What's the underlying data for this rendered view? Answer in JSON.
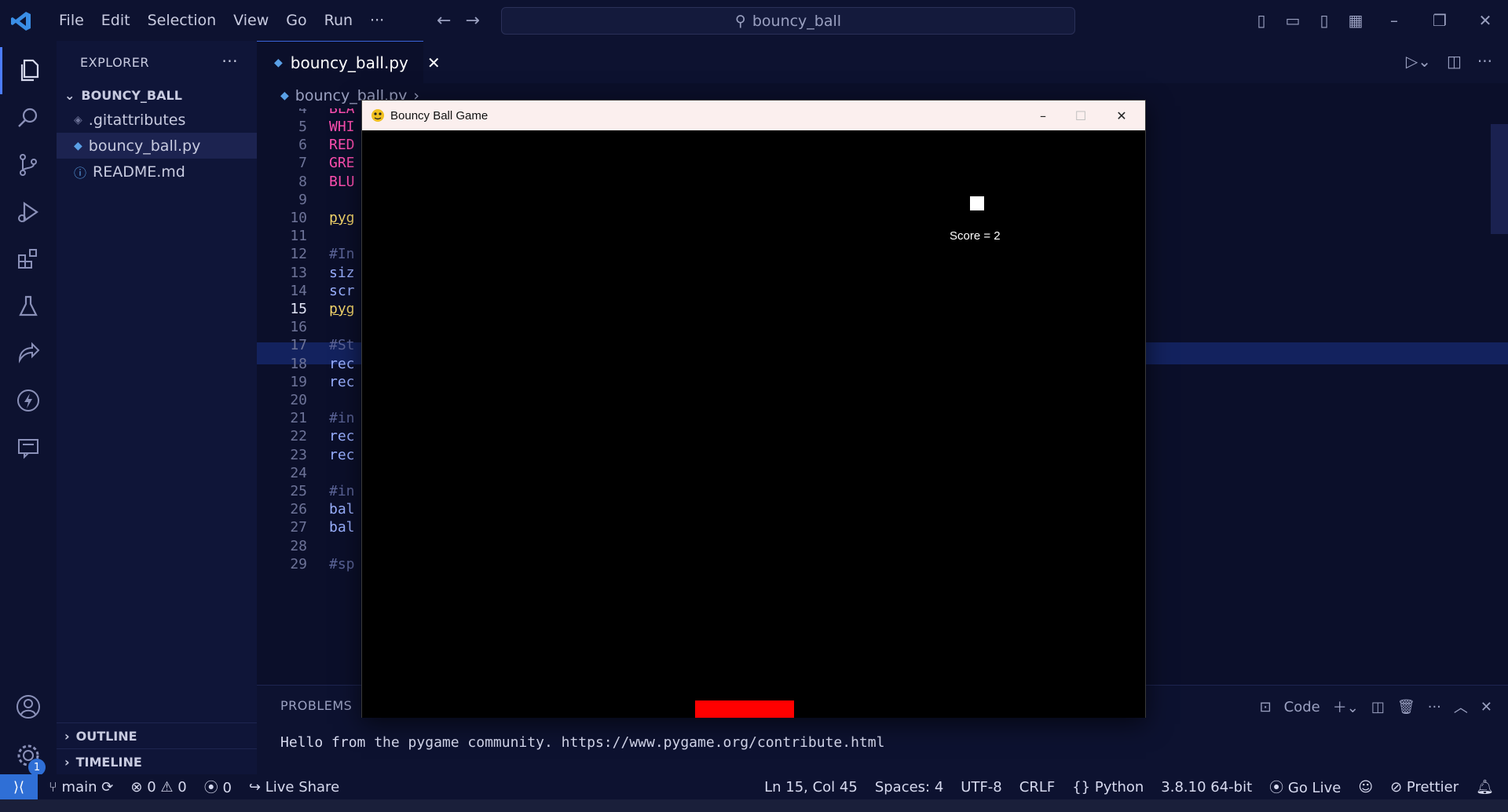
{
  "titlebar": {
    "menu": [
      "File",
      "Edit",
      "Selection",
      "View",
      "Go",
      "Run",
      "···"
    ],
    "search": "bouncy_ball"
  },
  "activity": {
    "badge": "1"
  },
  "sidebar": {
    "header": "EXPLORER",
    "project": "BOUNCY_BALL",
    "files": [
      ".gitattributes",
      "bouncy_ball.py",
      "README.md"
    ],
    "outline": "OUTLINE",
    "timeline": "TIMELINE"
  },
  "editor": {
    "tab": "bouncy_ball.py",
    "breadcrumb": "bouncy_ball.py",
    "lines": [
      {
        "n": "4",
        "t": "BLA",
        "c": "#ff4fb0"
      },
      {
        "n": "5",
        "t": "WHI",
        "c": "#ff4fb0"
      },
      {
        "n": "6",
        "t": "RED",
        "c": "#ff4fb0"
      },
      {
        "n": "7",
        "t": "GRE",
        "c": "#ff4fb0"
      },
      {
        "n": "8",
        "t": "BLU",
        "c": "#ff4fb0"
      },
      {
        "n": "9",
        "t": "",
        "c": "#c8cbe0"
      },
      {
        "n": "10",
        "t": "pyg",
        "c": "#f3d56b"
      },
      {
        "n": "11",
        "t": "",
        "c": "#c8cbe0"
      },
      {
        "n": "12",
        "t": "#In",
        "c": "#5a6396"
      },
      {
        "n": "13",
        "t": "siz",
        "c": "#9ab0ff"
      },
      {
        "n": "14",
        "t": "scr",
        "c": "#9ab0ff"
      },
      {
        "n": "15",
        "t": "pyg",
        "c": "#f3d56b"
      },
      {
        "n": "16",
        "t": "",
        "c": "#c8cbe0"
      },
      {
        "n": "17",
        "t": "#St",
        "c": "#5a6396"
      },
      {
        "n": "18",
        "t": "rec",
        "c": "#9ab0ff"
      },
      {
        "n": "19",
        "t": "rec",
        "c": "#9ab0ff"
      },
      {
        "n": "20",
        "t": "",
        "c": "#c8cbe0"
      },
      {
        "n": "21",
        "t": "#in",
        "c": "#5a6396"
      },
      {
        "n": "22",
        "t": "rec",
        "c": "#9ab0ff"
      },
      {
        "n": "23",
        "t": "rec",
        "c": "#9ab0ff"
      },
      {
        "n": "24",
        "t": "",
        "c": "#c8cbe0"
      },
      {
        "n": "25",
        "t": "#in",
        "c": "#5a6396"
      },
      {
        "n": "26",
        "t": "bal",
        "c": "#9ab0ff"
      },
      {
        "n": "27",
        "t": "bal",
        "c": "#9ab0ff"
      },
      {
        "n": "28",
        "t": "",
        "c": "#c8cbe0"
      },
      {
        "n": "29",
        "t": "#sp",
        "c": "#5a6396"
      }
    ],
    "current_line": "15"
  },
  "panel": {
    "tab": "PROBLEMS",
    "terminal_name": "Code",
    "output": "Hello from the pygame community. https://www.pygame.org/contribute.html"
  },
  "status": {
    "branch": "main",
    "errors": "0",
    "warnings": "0",
    "ports": "0",
    "live_share": "Live Share",
    "position": "Ln 15, Col 45",
    "spaces": "Spaces: 4",
    "encoding": "UTF-8",
    "eol": "CRLF",
    "language": "Python",
    "interpreter": "3.8.10 64-bit",
    "go_live": "Go Live",
    "prettier": "Prettier"
  },
  "game": {
    "title": "Bouncy Ball Game",
    "score": "Score = 2"
  },
  "colors": {
    "accent": "#2f6fd6",
    "paddle": "#ff0000",
    "ball": "#ffffff"
  }
}
